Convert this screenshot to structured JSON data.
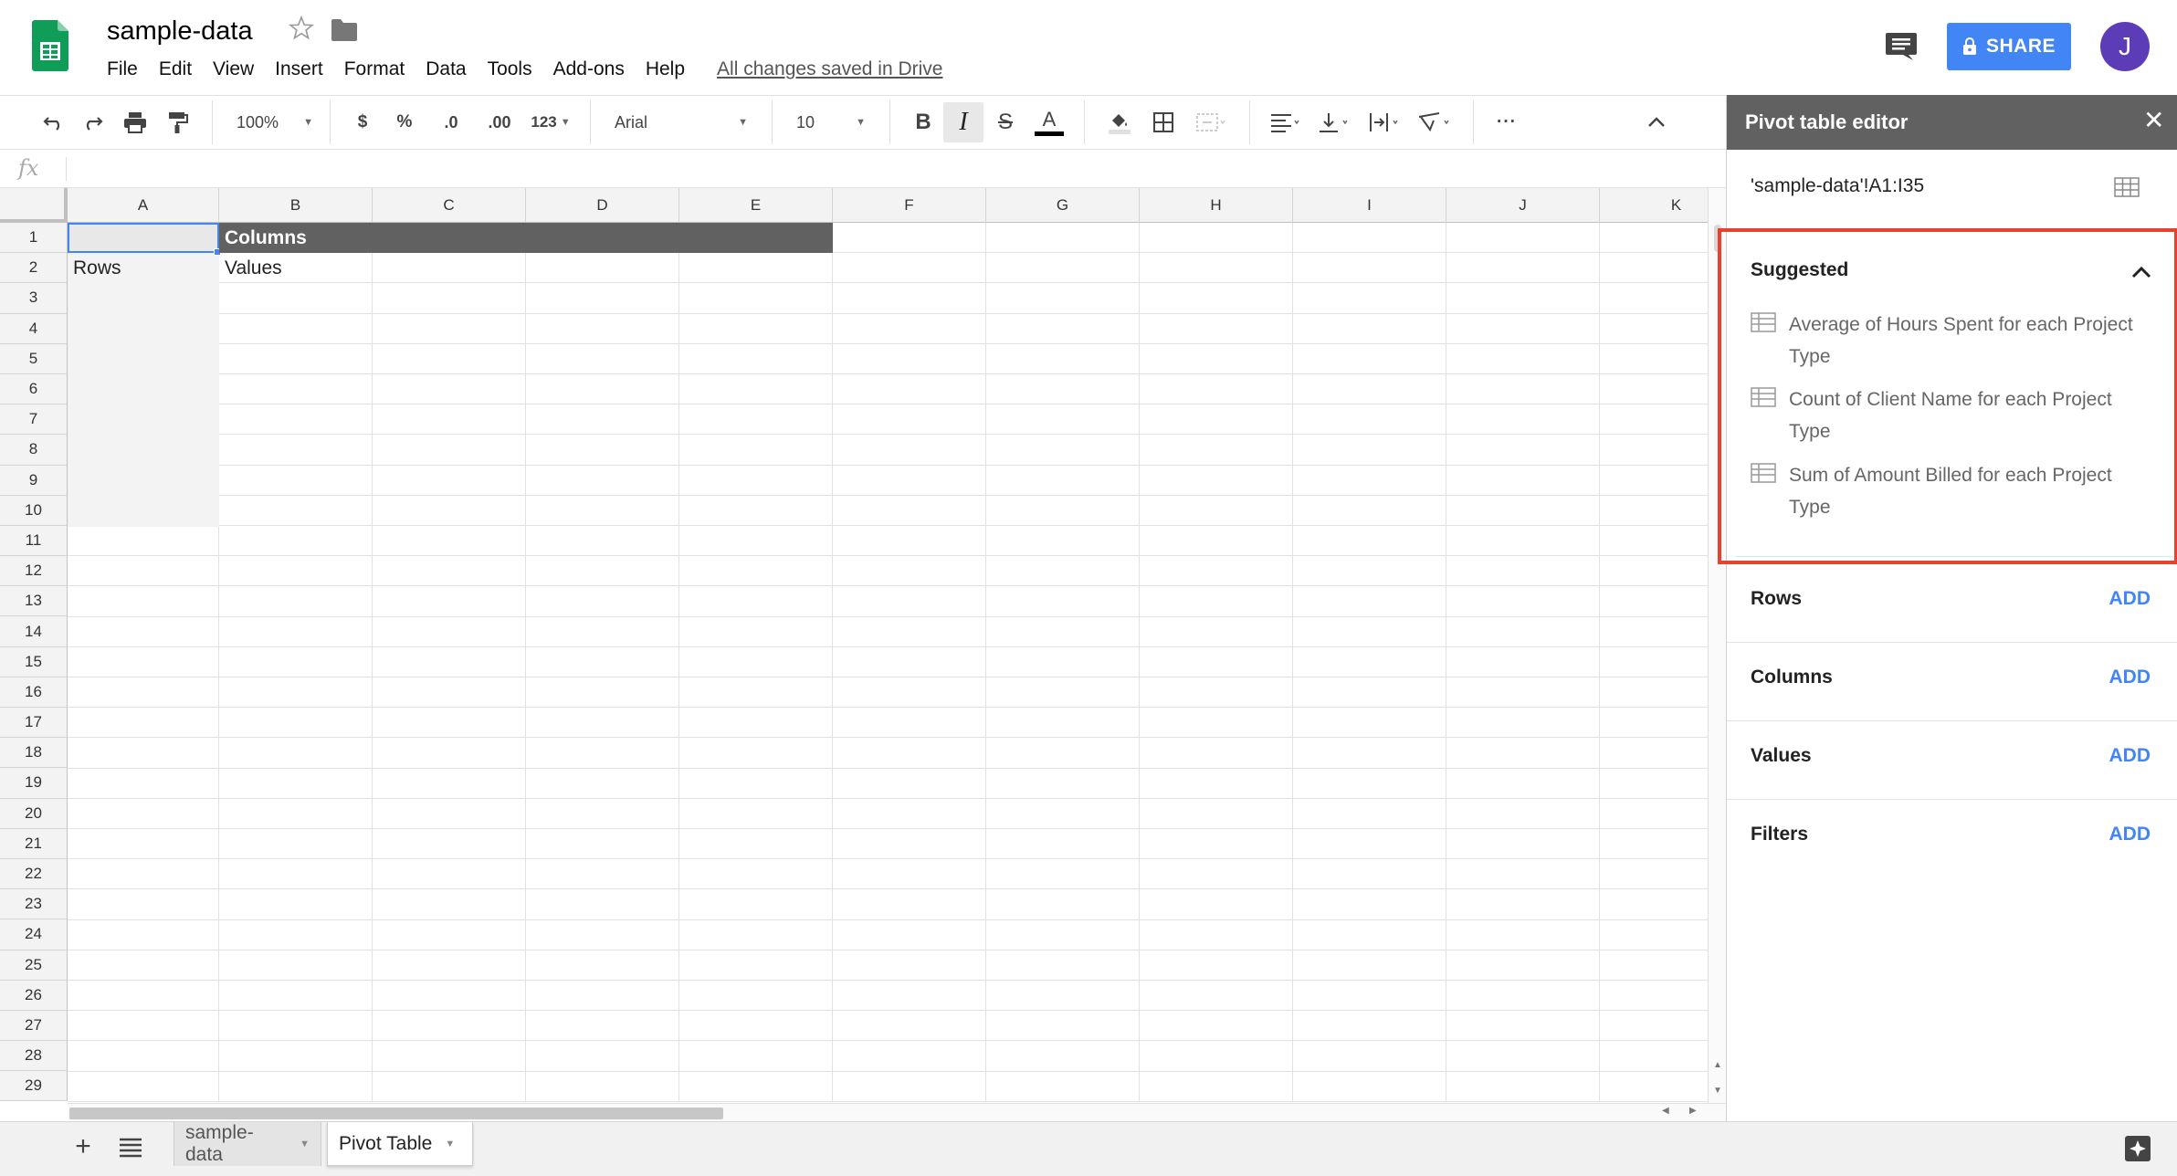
{
  "app": {
    "doc_title": "sample-data",
    "icons": {
      "logo": "sheets-logo-icon",
      "star": "star-icon",
      "folder": "folder-icon",
      "comments": "comments-icon",
      "lock": "lock-icon"
    },
    "share_label": "SHARE",
    "avatar_initial": "J",
    "avatar_color": "#5d3cb7",
    "brand_color": "#0f9d58",
    "accent_color": "#4285f4"
  },
  "menu": {
    "items": [
      "File",
      "Edit",
      "View",
      "Insert",
      "Format",
      "Data",
      "Tools",
      "Add-ons",
      "Help"
    ],
    "saved_status": "All changes saved in Drive"
  },
  "toolbar": {
    "zoom": "100%",
    "currency": "$",
    "percent": "%",
    "decrease_decimal": ".0",
    "increase_decimal": ".00",
    "more_formats": "123",
    "font": "Arial",
    "font_size": "10",
    "bold": "B",
    "italic": "I",
    "strikethrough": "S",
    "text_color": "A",
    "more": "···"
  },
  "formula_bar": {
    "fx": "fx",
    "value": ""
  },
  "grid": {
    "columns": [
      "A",
      "B",
      "C",
      "D",
      "E",
      "F",
      "G",
      "H",
      "I",
      "J",
      "K"
    ],
    "rows": [
      "1",
      "2",
      "3",
      "4",
      "5",
      "6",
      "7",
      "8",
      "9",
      "10",
      "11",
      "12",
      "13",
      "14",
      "15",
      "16",
      "17",
      "18",
      "19",
      "20",
      "21",
      "22",
      "23",
      "24",
      "25",
      "26",
      "27",
      "28",
      "29"
    ],
    "cells": {
      "columns_header": "Columns",
      "rows_label": "Rows",
      "values_label": "Values"
    }
  },
  "sheets": {
    "tabs": [
      {
        "label": "sample-data",
        "active": false
      },
      {
        "label": "Pivot Table",
        "active": true
      }
    ]
  },
  "pivot_editor": {
    "title": "Pivot table editor",
    "close": "✕",
    "range": "'sample-data'!A1:I35",
    "suggested": {
      "title": "Suggested",
      "highlight_color": "#e8412f",
      "items": [
        {
          "line1": "Average of Hours Spent for each Project",
          "line2": "Type"
        },
        {
          "line1": "Count of Client Name for each Project",
          "line2": "Type"
        },
        {
          "line1": "Sum of Amount Billed for each Project",
          "line2": "Type"
        }
      ]
    },
    "sections": [
      {
        "label": "Rows",
        "action": "ADD"
      },
      {
        "label": "Columns",
        "action": "ADD"
      },
      {
        "label": "Values",
        "action": "ADD"
      },
      {
        "label": "Filters",
        "action": "ADD"
      }
    ]
  }
}
